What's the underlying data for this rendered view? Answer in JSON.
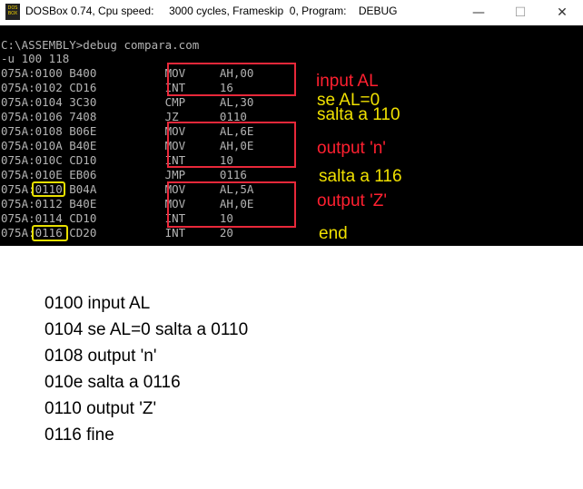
{
  "window": {
    "title": "DOSBox 0.74, Cpu speed:     3000 cycles, Frameskip  0, Program:    DEBUG",
    "icon_label": "DOS BOX",
    "buttons": {
      "minimize": "—",
      "maximize": "☐",
      "close": "✕"
    }
  },
  "console": {
    "lines": [
      "C:\\ASSEMBLY>debug compara.com",
      "-u 100 118",
      "075A:0100 B400          MOV     AH,00",
      "075A:0102 CD16          INT     16",
      "075A:0104 3C30          CMP     AL,30",
      "075A:0106 7408          JZ      0110",
      "075A:0108 B06E          MOV     AL,6E",
      "075A:010A B40E          MOV     AH,0E",
      "075A:010C CD10          INT     10",
      "075A:010E EB06          JMP     0116",
      "075A:0110 B04A          MOV     AL,5A",
      "075A:0112 B40E          MOV     AH,0E",
      "075A:0114 CD10          INT     10",
      "075A:0116 CD20          INT     20"
    ]
  },
  "annotations": {
    "input_al": "input AL",
    "se_al": "se AL=0",
    "salta_110": "salta a 110",
    "output_n": "output 'n'",
    "salta_116": "salta a 116",
    "output_z": "output 'Z'",
    "end": "end"
  },
  "notes": [
    "0100 input AL",
    "0104 se AL=0 salta a 0110",
    "0108 output 'n'",
    "010e salta a 0116",
    "0110 output 'Z'",
    "0116 fine"
  ],
  "colors": {
    "console_bg": "#000000",
    "console_text": "#b4b4b4",
    "red": "#e8283a",
    "yellow": "#f0e000"
  }
}
